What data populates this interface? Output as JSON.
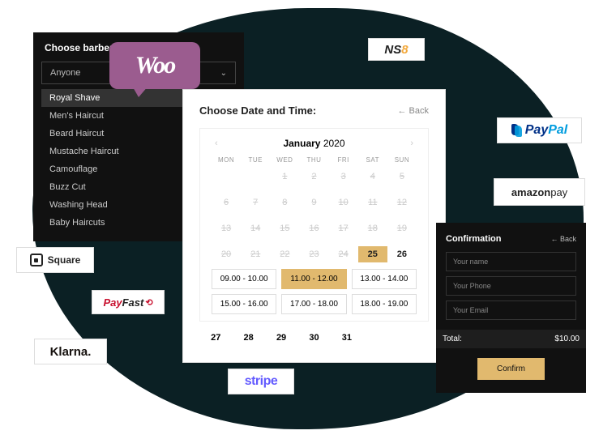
{
  "barber": {
    "title": "Choose barber:",
    "selected": "Anyone",
    "options": [
      "Royal Shave",
      "Men's Haircut",
      "Beard Haircut",
      "Mustache Haircut",
      "Camouflage",
      "Buzz Cut",
      "Washing Head",
      "Baby Haircuts"
    ]
  },
  "datetime": {
    "title": "Choose Date and Time:",
    "back": "Back",
    "month": "January",
    "year": "2020",
    "dow": [
      "MON",
      "TUE",
      "WED",
      "THU",
      "FRI",
      "SAT",
      "SUN"
    ],
    "weeks": [
      [
        {
          "n": "",
          "e": true
        },
        {
          "n": "",
          "e": true
        },
        {
          "n": "1",
          "d": true
        },
        {
          "n": "2",
          "d": true
        },
        {
          "n": "3",
          "d": true
        },
        {
          "n": "4",
          "d": true
        },
        {
          "n": "5",
          "d": true
        }
      ],
      [
        {
          "n": "6",
          "d": true
        },
        {
          "n": "7",
          "d": true
        },
        {
          "n": "8",
          "d": true
        },
        {
          "n": "9",
          "d": true
        },
        {
          "n": "10",
          "d": true
        },
        {
          "n": "11",
          "d": true
        },
        {
          "n": "12",
          "d": true
        }
      ],
      [
        {
          "n": "13",
          "d": true
        },
        {
          "n": "14",
          "d": true
        },
        {
          "n": "15",
          "d": true
        },
        {
          "n": "16",
          "d": true
        },
        {
          "n": "17",
          "d": true
        },
        {
          "n": "18",
          "d": true
        },
        {
          "n": "19",
          "d": true
        }
      ],
      [
        {
          "n": "20",
          "d": true
        },
        {
          "n": "21",
          "d": true
        },
        {
          "n": "22",
          "d": true
        },
        {
          "n": "23",
          "d": true
        },
        {
          "n": "24",
          "d": true
        },
        {
          "n": "25",
          "sel": true
        },
        {
          "n": "26",
          "b": true
        }
      ]
    ],
    "extra_days": [
      "27",
      "28",
      "29",
      "30",
      "31",
      "",
      ""
    ],
    "slots": [
      {
        "t": "09.00 - 10.00"
      },
      {
        "t": "11.00 - 12.00",
        "sel": true
      },
      {
        "t": "13.00 - 14.00"
      },
      {
        "t": "15.00 - 16.00"
      },
      {
        "t": "17.00 - 18.00"
      },
      {
        "t": "18.00 - 19.00"
      }
    ]
  },
  "confirmation": {
    "title": "Confirmation",
    "back": "Back",
    "name_ph": "Your name",
    "phone_ph": "Your Phone",
    "email_ph": "Your Email",
    "total_label": "Total:",
    "total_value": "$10.00",
    "confirm": "Confirm"
  },
  "logos": {
    "woo": "Woo",
    "ns8_a": "NS",
    "ns8_b": "8",
    "paypal_a": "Pay",
    "paypal_b": "Pal",
    "amazon_a": "amazon",
    "amazon_b": " pay",
    "square": "Square",
    "payfast_a": "Pay",
    "payfast_b": "Fast",
    "klarna": "Klarna.",
    "stripe": "stripe"
  }
}
